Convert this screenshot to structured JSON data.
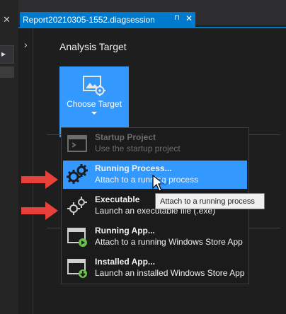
{
  "tab": {
    "title": "Report20210305-1552.diagsession",
    "pin_glyph": "⊓",
    "close_glyph": "✕"
  },
  "left_pane": {
    "close_glyph": "✕",
    "dropdown_glyph": "▸"
  },
  "expander_glyph": "›",
  "section": {
    "title": "Analysis Target"
  },
  "choose_target": {
    "label": "Choose Target",
    "icon": "picture-gear-icon"
  },
  "menu": {
    "items": [
      {
        "title": "Startup Project",
        "subtitle": "Use the startup project",
        "icon": "startup-window-icon",
        "state": "disabled"
      },
      {
        "title": "Running Process...",
        "subtitle": "Attach to a running process",
        "icon": "gears-icon",
        "state": "highlighted"
      },
      {
        "title": "Executable",
        "subtitle": "Launch an executable file (.exe)",
        "icon": "gears-small-icon",
        "state": "normal"
      },
      {
        "title": "Running App...",
        "subtitle": "Attach to a running Windows Store App",
        "icon": "window-play-icon",
        "state": "normal"
      },
      {
        "title": "Installed App...",
        "subtitle": "Launch an installed Windows Store App",
        "icon": "window-download-icon",
        "state": "normal"
      }
    ]
  },
  "tooltip": {
    "text": "Attach to a running process"
  },
  "colors": {
    "accent": "#3399ff",
    "tab_active": "#007acc",
    "annotation_arrow": "#e8413a",
    "app_badge": "#6bbf4e"
  }
}
